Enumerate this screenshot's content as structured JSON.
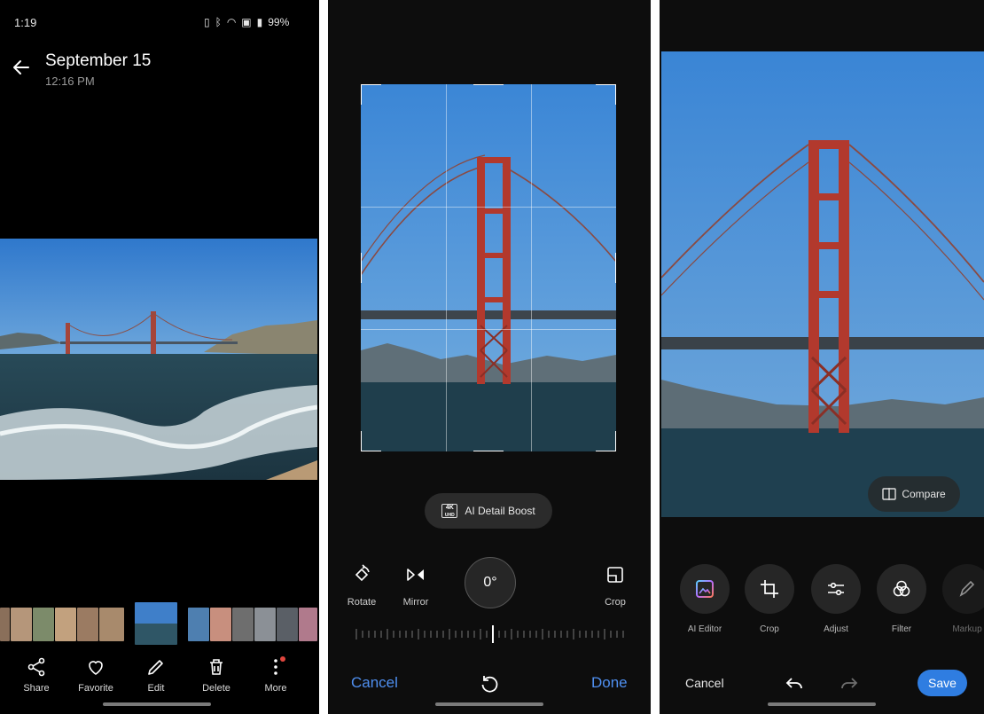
{
  "screens": {
    "viewer": {
      "status": {
        "time": "1:19",
        "battery": "99%"
      },
      "header": {
        "title": "September 15",
        "time": "12:16 PM"
      },
      "actions": [
        {
          "label": "Share",
          "icon": "share-icon"
        },
        {
          "label": "Favorite",
          "icon": "heart-icon"
        },
        {
          "label": "Edit",
          "icon": "pencil-icon"
        },
        {
          "label": "Delete",
          "icon": "trash-icon"
        },
        {
          "label": "More",
          "icon": "more-vertical-icon"
        }
      ]
    },
    "crop": {
      "ai_boost": {
        "badge": "4K",
        "badge_sub": "UHD",
        "label": "AI Detail Boost"
      },
      "tools": {
        "rotate": "Rotate",
        "mirror": "Mirror",
        "crop": "Crop"
      },
      "angle": "0°",
      "cancel": "Cancel",
      "done": "Done"
    },
    "editor": {
      "compare": "Compare",
      "tools": [
        {
          "label": "AI Editor",
          "icon": "ai-editor-icon"
        },
        {
          "label": "Crop",
          "icon": "crop-icon"
        },
        {
          "label": "Adjust",
          "icon": "sliders-icon"
        },
        {
          "label": "Filter",
          "icon": "filter-icon"
        },
        {
          "label": "Markup",
          "icon": "pen-icon"
        }
      ],
      "cancel": "Cancel",
      "save": "Save"
    }
  },
  "colors": {
    "accent": "#4f8ff0",
    "save": "#2f7de1",
    "sky": "#3f86d3",
    "bridge": "#b23a2e",
    "water": "#2f4f5a"
  }
}
